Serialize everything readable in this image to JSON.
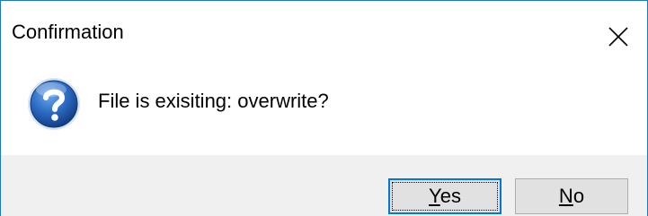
{
  "window": {
    "title": "Confirmation"
  },
  "message": {
    "text": "File is exisiting: overwrite?",
    "icon": "question-icon"
  },
  "buttons": {
    "yes": {
      "accel": "Y",
      "rest": "es"
    },
    "no": {
      "accel": "N",
      "rest": "o"
    }
  },
  "colors": {
    "accent": "#0078d7",
    "button_bar": "#f0f0f0",
    "icon_blue": "#1f5fb0"
  }
}
